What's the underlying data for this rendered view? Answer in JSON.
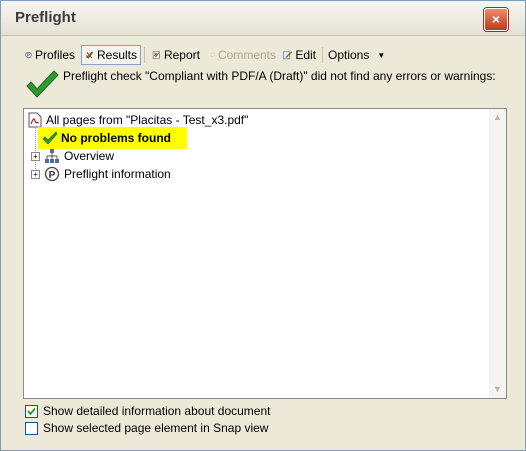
{
  "window": {
    "title": "Preflight",
    "close_label": "×"
  },
  "toolbar": {
    "profiles": "Profiles",
    "results": "Results",
    "report": "Report",
    "comments": "Comments",
    "edit": "Edit",
    "options": "Options"
  },
  "message": "Preflight check \"Compliant with PDF/A (Draft)\" did not find any errors or warnings:",
  "tree": {
    "root": "All pages from \"Placitas - Test_x3.pdf\"",
    "result": "No problems found",
    "overview": "Overview",
    "preflight_info": "Preflight information"
  },
  "options": {
    "show_detailed": {
      "label": "Show detailed information about document",
      "checked": true
    },
    "show_snap": {
      "label": "Show selected page element in Snap view",
      "checked": false
    }
  },
  "colors": {
    "highlight": "#ffff00",
    "check_green": "#2f9a2f"
  }
}
